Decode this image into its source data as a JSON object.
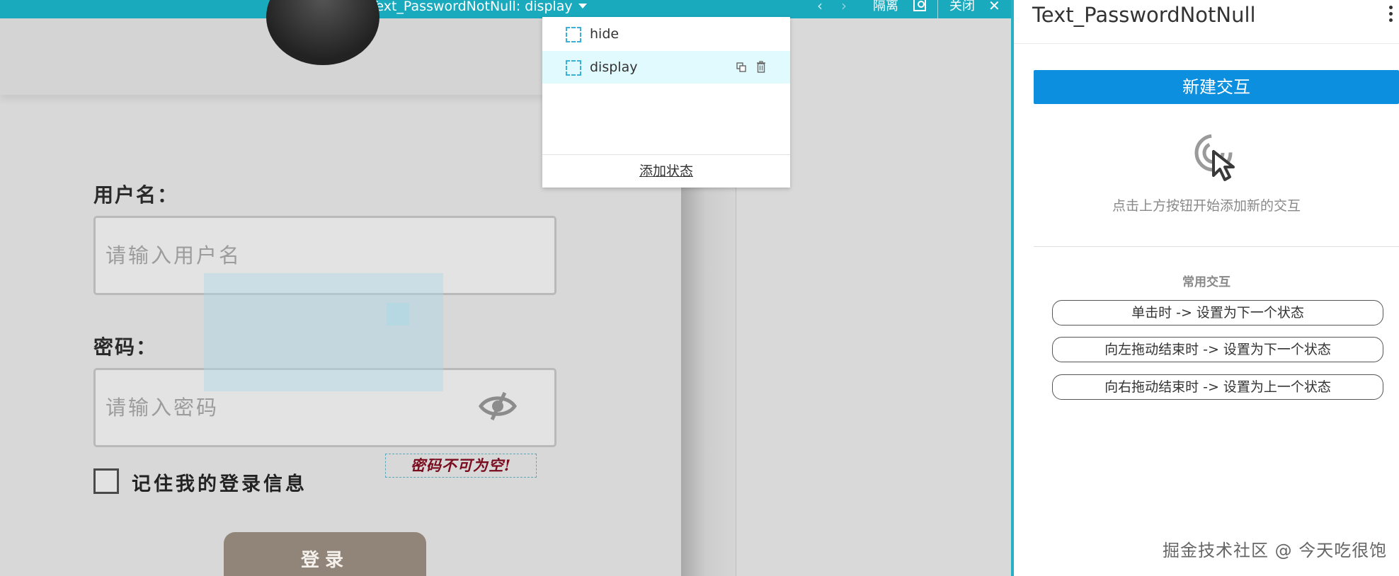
{
  "topbar": {
    "title": "Text_PasswordNotNull: display",
    "prev_label": "‹",
    "next_label": "›",
    "isolate_label": "隔离",
    "close_label": "关闭",
    "close_glyph": "✕"
  },
  "form": {
    "username_label": "用户名：",
    "username_placeholder": "请输入用户名",
    "password_label": "密码：",
    "password_placeholder": "请输入密码",
    "error_text": "密码不可为空!",
    "remember_label": "记住我的登录信息",
    "login_label": "登录"
  },
  "states": {
    "items": [
      {
        "name": "hide",
        "active": false
      },
      {
        "name": "display",
        "active": true
      }
    ],
    "add_label": "添加状态"
  },
  "panel": {
    "title": "Text_PasswordNotNull",
    "new_interaction_label": "新建交互",
    "empty_hint": "点击上方按钮开始添加新的交互",
    "common_title": "常用交互",
    "quick_items": [
      "单击时 -> 设置为下一个状态",
      "向左拖动结束时 -> 设置为下一个状态",
      "向右拖动结束时 -> 设置为上一个状态"
    ],
    "watermark": "掘金技术社区 @ 今天吃很饱"
  },
  "colors": {
    "topbar": "#1aaabe",
    "primary_button": "#0d8fdf",
    "login_button": "#918579",
    "error_text": "#7a0c1e",
    "active_state": "#e1fafd"
  }
}
